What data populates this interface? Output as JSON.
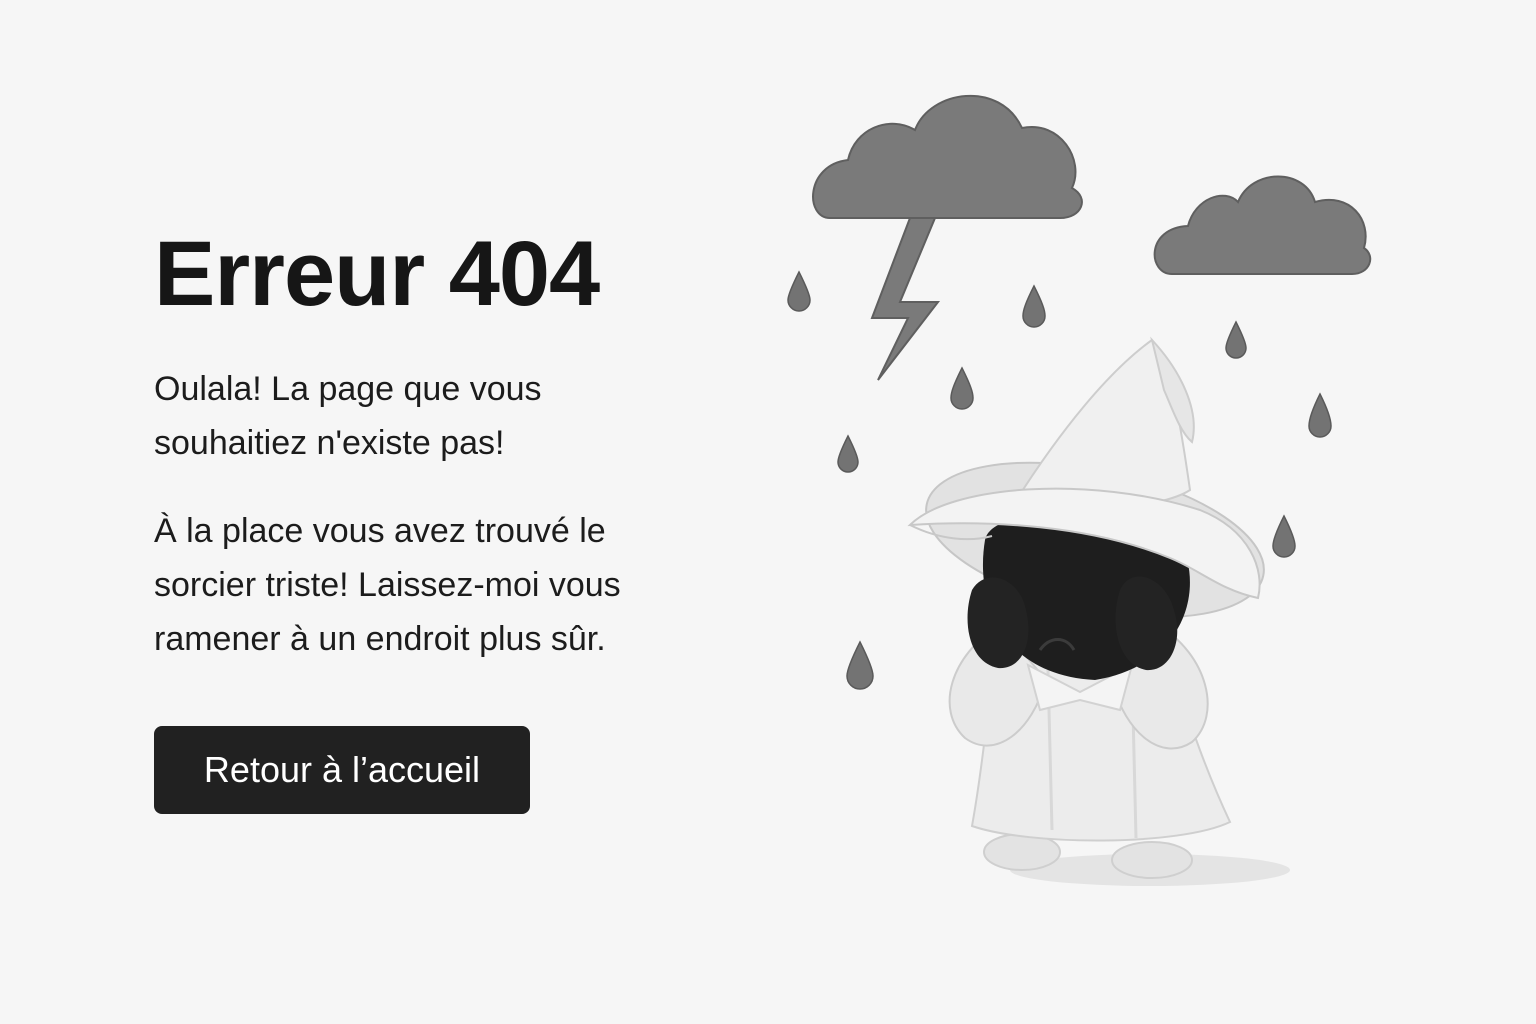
{
  "error": {
    "title": "Erreur 404",
    "message_1": "Oulala! La page que vous souhaitiez n'existe pas!",
    "message_2": "À la place vous avez trouvé le sorcier triste! Laissez-moi vous ramener à un endroit plus sûr."
  },
  "actions": {
    "home_label": "Retour à l’accueil"
  },
  "illustration": {
    "subject": "sad-wizard-icon",
    "elements": [
      "storm-cloud-icon",
      "lightning-bolt-icon",
      "rain-cloud-icon",
      "raindrop-icon"
    ]
  },
  "colors": {
    "background": "#f6f6f6",
    "text": "#161616",
    "button": "#212121",
    "button_text": "#ffffff",
    "cloud": "#7a7a7a",
    "raindrop": "#737373",
    "robe": "#ebebeb",
    "face": "#1e1e1e"
  }
}
